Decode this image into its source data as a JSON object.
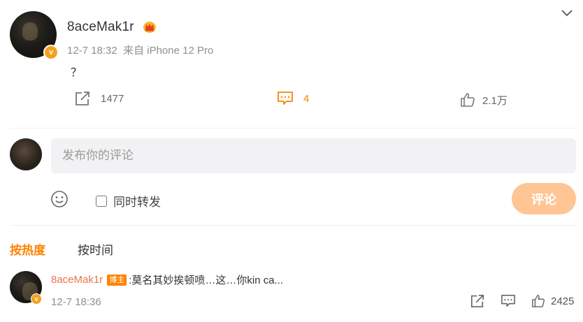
{
  "post": {
    "author": "8aceMak1r",
    "time": "12-7 18:32",
    "source": "来自 iPhone 12 Pro",
    "text": "？",
    "verify_mark": "v"
  },
  "actions": {
    "share_count": "1477",
    "comment_count": "4",
    "like_count": "2.1万"
  },
  "compose": {
    "placeholder": "发布你的评论",
    "repost_label": "同时转发",
    "submit_label": "评论"
  },
  "sort": {
    "hot_label": "按热度",
    "time_label": "按时间"
  },
  "comments": [
    {
      "user": "8aceMak1r",
      "tag": "博主",
      "text": ":莫名其妙挨顿喷…这…你kin ca...",
      "time": "12-7 18:36",
      "like_count": "2425"
    }
  ],
  "colors": {
    "accent": "#ff8200",
    "username_link": "#eb7350",
    "submit_disabled": "#ffc594",
    "input_bg": "#f2f2f4"
  },
  "icons": [
    "chevron-down-icon",
    "crown-icon",
    "share-icon",
    "comment-icon",
    "like-icon",
    "emoji-icon",
    "verify-icon"
  ]
}
